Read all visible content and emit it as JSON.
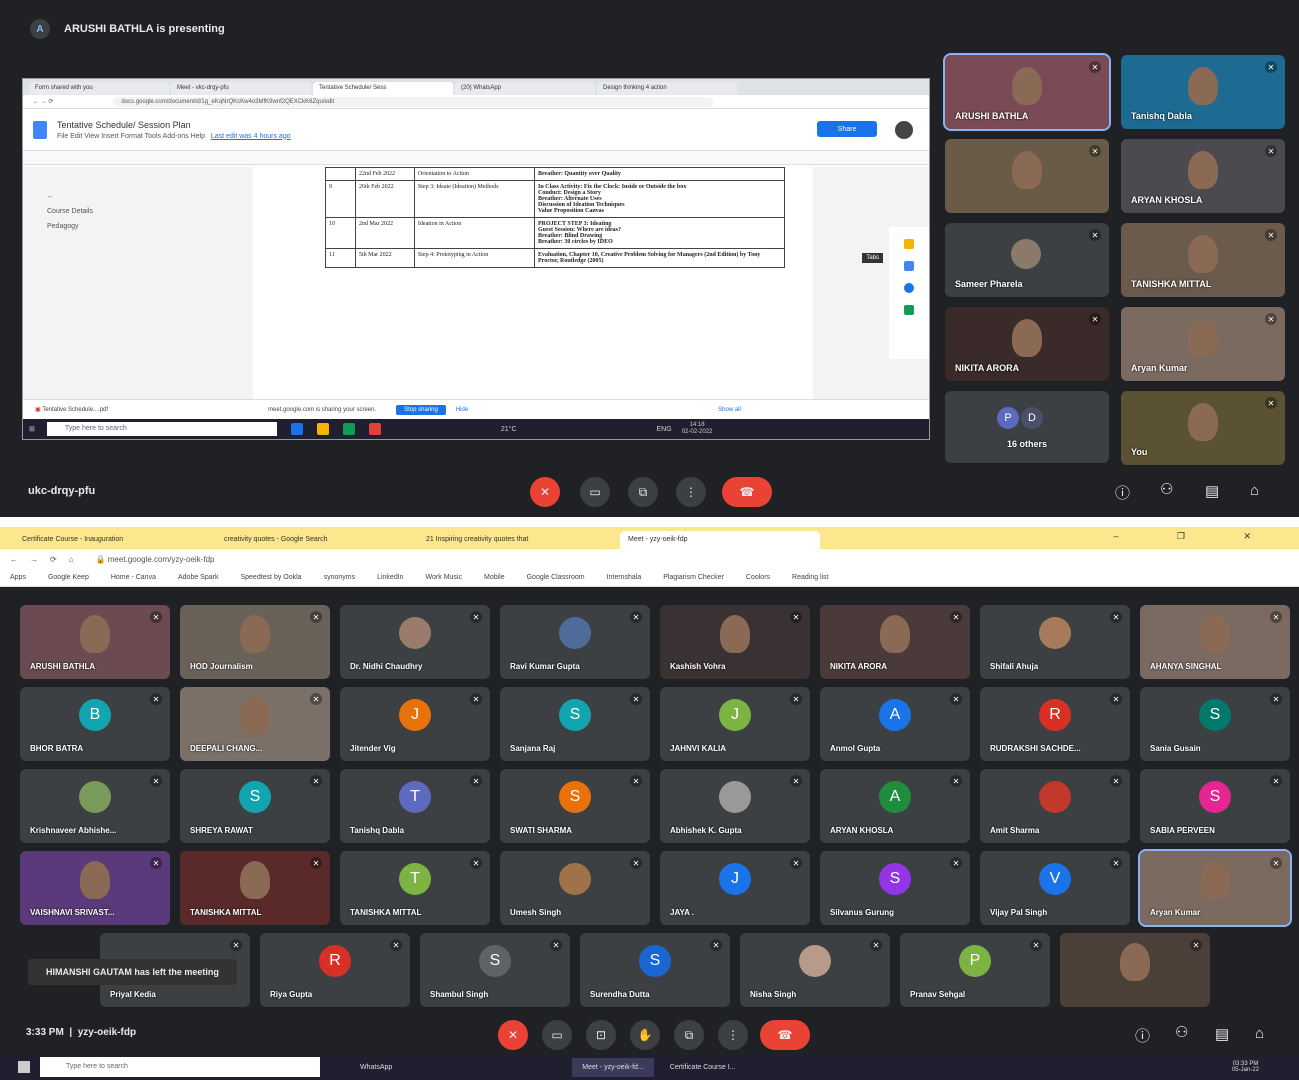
{
  "top": {
    "presenter_initial": "A",
    "presenter_banner": "ARUSHI BATHLA is presenting",
    "shared_screen": {
      "tabs": [
        "Form shared with you",
        "Meet - vkc-drqy-pfu",
        "Tentative Schedule/ Sess",
        "(20) WhatsApp",
        "Design thinking 4 action"
      ],
      "address": "docs.google.com/document/d/1g_eKqNrQKcKw4o3MfK9wnf2QEXCkK6Zqu/edit",
      "doc_title": "Tentative Schedule/ Session Plan",
      "doc_menu": "File  Edit  View  Insert  Format  Tools  Add-ons  Help",
      "last_edit": "Last edit was 4 hours ago",
      "share_label": "Share",
      "outline": [
        "Course Details",
        "Pedagogy"
      ],
      "rows": [
        {
          "num": "",
          "date": "22nd Feb 2022",
          "topic": "Orientation to Action",
          "details": [
            "Breather: Quantity over Quality"
          ]
        },
        {
          "num": "9",
          "date": "26th Feb 2022",
          "topic": "Step 3: Ideate (Ideation) Methods",
          "details": [
            "In Class Activity: Fix the Clock: Inside or Outside the box",
            "Conduct: Design a Story",
            "Breather: Alternate Uses",
            "Discussion of Ideation Techniques",
            "Value Proposition Canvas"
          ]
        },
        {
          "num": "10",
          "date": "2nd Mar 2022",
          "topic": "Ideation in Action",
          "details": [
            "PROJECT STEP 3: Ideating",
            "Guest Session: Where are ideas?",
            "Breather: Blind Drawing",
            "Breather: 30 circles by IDEO"
          ]
        },
        {
          "num": "11",
          "date": "5th Mar 2022",
          "topic": "Step 4: Prototyping in Action",
          "details": [
            "Evaluation, Chapter 10, Creative Problem Solving for Managers (2nd Edition) by Tony Proctor, Routledge (2005)"
          ]
        }
      ],
      "download_file": "Tentative Schedule....pdf",
      "sharing_msg": "meet.google.com is sharing your screen.",
      "stop_sharing": "Stop sharing",
      "hide": "Hide",
      "show_all": "Show all",
      "taskbar_search": "Type here to search",
      "weather": "21°C",
      "lang": "ENG",
      "clock_time": "14:18",
      "clock_date": "02-02-2022",
      "side_chip": "Tabs"
    },
    "participants": [
      {
        "name": "ARUSHI BATHLA",
        "cam": true,
        "highlight": true,
        "bg": "#7a4a55"
      },
      {
        "name": "Tanishq Dabla",
        "cam": true,
        "highlight": false,
        "bg": "#1d6b92"
      },
      {
        "name": "",
        "cam": true,
        "highlight": false,
        "bg": "#6a5a48"
      },
      {
        "name": "ARYAN KHOSLA",
        "cam": true,
        "highlight": false,
        "bg": "#4a4a50"
      },
      {
        "name": "Sameer Pharela",
        "cam": false,
        "highlight": false,
        "bg": "#3c4043"
      },
      {
        "name": "TANISHKA MITTAL",
        "cam": true,
        "highlight": false,
        "bg": "#6b5b4d"
      },
      {
        "name": "NIKITA ARORA",
        "cam": true,
        "highlight": false,
        "bg": "#3a2a2a"
      },
      {
        "name": "Aryan Kumar",
        "cam": true,
        "highlight": false,
        "bg": "#7a6a60"
      },
      {
        "name": "You",
        "cam": true,
        "highlight": false,
        "bg": "#5a5232"
      }
    ],
    "others_label": "16 others",
    "others_initials": [
      "P",
      "D"
    ],
    "meeting_code": "ukc-drqy-pfu"
  },
  "bottom": {
    "tabs": [
      "Certificate Course - Inauguration",
      "creativity quotes - Google Search",
      "21 Inspiring creativity quotes that",
      "Meet - yzy-oeik-fdp"
    ],
    "url": "meet.google.com/yzy-oeik-fdp",
    "bookmarks": [
      "Apps",
      "Google Keep",
      "Home - Canva",
      "Adobe Spark",
      "Speedtest by Ookla",
      "synonyms",
      "LinkedIn",
      "Work Music",
      "Mobile",
      "Google Classroom",
      "Internshala",
      "Plagiarism Checker",
      "Coolors",
      "Reading list"
    ],
    "tiles": [
      {
        "name": "ARUSHI BATHLA",
        "type": "cam",
        "bg": "#6b4a52"
      },
      {
        "name": "HOD Journalism",
        "type": "cam",
        "bg": "#6a6258"
      },
      {
        "name": "Dr. Nidhi Chaudhry",
        "type": "pic",
        "bg": "#3c4043",
        "pic": "#9a7a6a"
      },
      {
        "name": "Ravi Kumar Gupta",
        "type": "pic",
        "bg": "#3c4043",
        "pic": "#4f6b9a"
      },
      {
        "name": "Kashish Vohra",
        "type": "cam",
        "bg": "#3a3232"
      },
      {
        "name": "NIKITA ARORA",
        "type": "cam",
        "bg": "#4a3a3a"
      },
      {
        "name": "Shifali Ahuja",
        "type": "pic",
        "bg": "#3c4043",
        "pic": "#a67a5a"
      },
      {
        "name": "AHANYA SINGHAL",
        "type": "cam",
        "bg": "#7a6a62"
      },
      {
        "name": "BHOR BATRA",
        "type": "letter",
        "letter": "B",
        "color": "#12a4af"
      },
      {
        "name": "DEEPALI CHANG...",
        "type": "cam",
        "bg": "#7a7068"
      },
      {
        "name": "Jitender Vig",
        "type": "letter",
        "letter": "J",
        "color": "#e8710a"
      },
      {
        "name": "Sanjana Raj",
        "type": "letter",
        "letter": "S",
        "color": "#12a4af"
      },
      {
        "name": "JAHNVI KALIA",
        "type": "letter",
        "letter": "J",
        "color": "#7cb342"
      },
      {
        "name": "Anmol Gupta",
        "type": "letter",
        "letter": "A",
        "color": "#1a73e8"
      },
      {
        "name": "RUDRAKSHI SACHDE...",
        "type": "letter",
        "letter": "R",
        "color": "#d93025"
      },
      {
        "name": "Sania Gusain",
        "type": "letter",
        "letter": "S",
        "color": "#00796b"
      },
      {
        "name": "Krishnaveer Abhishe...",
        "type": "pic",
        "bg": "#3c4043",
        "pic": "#7a9a5a"
      },
      {
        "name": "SHREYA RAWAT",
        "type": "letter",
        "letter": "S",
        "color": "#12a4af"
      },
      {
        "name": "Tanishq Dabla",
        "type": "letter",
        "letter": "T",
        "color": "#5c6bc0"
      },
      {
        "name": "SWATI SHARMA",
        "type": "letter",
        "letter": "S",
        "color": "#e8710a"
      },
      {
        "name": "Abhishek K. Gupta",
        "type": "pic",
        "bg": "#3c4043",
        "pic": "#999999"
      },
      {
        "name": "ARYAN KHOSLA",
        "type": "letter",
        "letter": "A",
        "color": "#1e8e3e"
      },
      {
        "name": "Amit Sharma",
        "type": "pic",
        "bg": "#3c4043",
        "pic": "#c0392b"
      },
      {
        "name": "SABIA PERVEEN",
        "type": "letter",
        "letter": "S",
        "color": "#e52592"
      },
      {
        "name": "VAISHNAVI SRIVAST...",
        "type": "cam",
        "bg": "#5a3a7a"
      },
      {
        "name": "TANISHKA MITTAL",
        "type": "cam",
        "bg": "#5a2a2a"
      },
      {
        "name": "TANISHKA MITTAL",
        "type": "letter",
        "letter": "T",
        "color": "#7cb342"
      },
      {
        "name": "Umesh Singh",
        "type": "pic",
        "bg": "#3c4043",
        "pic": "#a0724a"
      },
      {
        "name": "JAYA .",
        "type": "letter",
        "letter": "J",
        "color": "#1a73e8"
      },
      {
        "name": "Silvanus Gurung",
        "type": "letter",
        "letter": "S",
        "color": "#9334e6"
      },
      {
        "name": "Vijay Pal Singh",
        "type": "letter",
        "letter": "V",
        "color": "#1a73e8"
      },
      {
        "name": "Aryan Kumar",
        "type": "cam",
        "bg": "#7a6a60",
        "highlight": true
      },
      {
        "name": "Priyal Kedia",
        "type": "letter",
        "letter": "",
        "color": "#3c4043"
      },
      {
        "name": "Riya Gupta",
        "type": "letter",
        "letter": "R",
        "color": "#d93025"
      },
      {
        "name": "Shambul Singh",
        "type": "letter",
        "letter": "S",
        "color": "#5f6368"
      },
      {
        "name": "Surendha Dutta",
        "type": "letter",
        "letter": "S",
        "color": "#1967d2"
      },
      {
        "name": "Nisha Singh",
        "type": "pic",
        "bg": "#3c4043",
        "pic": "#b89a8a"
      },
      {
        "name": "Pranav Sehgal",
        "type": "letter",
        "letter": "P",
        "color": "#7cb342"
      },
      {
        "name": "",
        "type": "cam",
        "bg": "#4a4038"
      }
    ],
    "toast": "HIMANSHI GAUTAM has left the meeting",
    "time": "3:33 PM",
    "meeting_code": "yzy-oeik-fdp",
    "taskbar_search": "Type here to search",
    "taskbar_apps": [
      "WhatsApp",
      "Meet - yzy-oeik-fd...",
      "Certificate Course I..."
    ],
    "clock_time": "03:33 PM",
    "clock_date": "05-Jan-22"
  }
}
